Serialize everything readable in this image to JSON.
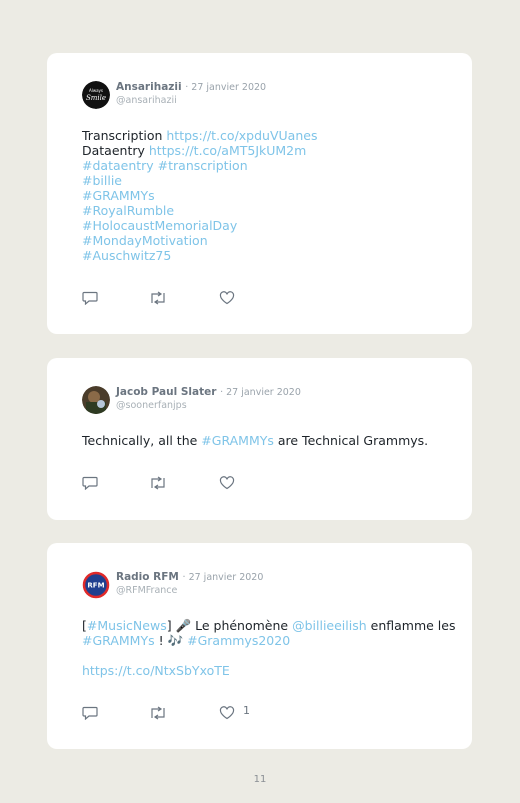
{
  "tweets": [
    {
      "name": "Ansarihazii",
      "date": "· 27 janvier 2020",
      "handle": "@ansarihazii",
      "lines": [
        [
          {
            "t": "Transcription ",
            "link": false
          },
          {
            "t": "https://t.co/xpduVUanes",
            "link": true
          }
        ],
        [
          {
            "t": "Dataentry ",
            "link": false
          },
          {
            "t": "https://t.co/aMT5JkUM2m",
            "link": true
          }
        ],
        [
          {
            "t": "#dataentry #transcription",
            "link": true
          }
        ],
        [
          {
            "t": "#billie",
            "link": true
          }
        ],
        [
          {
            "t": "#GRAMMYs",
            "link": true
          }
        ],
        [
          {
            "t": "#RoyalRumble",
            "link": true
          }
        ],
        [
          {
            "t": "#HolocaustMemorialDay",
            "link": true
          }
        ],
        [
          {
            "t": "#MondayMotivation",
            "link": true
          }
        ],
        [
          {
            "t": "#Auschwitz75",
            "link": true
          }
        ]
      ],
      "like_count": ""
    },
    {
      "name": "Jacob Paul Slater",
      "date": "· 27 janvier 2020",
      "handle": "@soonerfanjps",
      "lines": [
        [
          {
            "t": "Technically, all the ",
            "link": false
          },
          {
            "t": "#GRAMMYs",
            "link": true
          },
          {
            "t": " are Technical Grammys.",
            "link": false
          }
        ]
      ],
      "like_count": ""
    },
    {
      "name": "Radio RFM",
      "date": "· 27 janvier 2020",
      "handle": "@RFMFrance",
      "lines": [
        [
          {
            "t": "[",
            "link": false
          },
          {
            "t": "#MusicNews",
            "link": true
          },
          {
            "t": "] 🎤 Le phénomène ",
            "link": false
          },
          {
            "t": "@billieeilish",
            "link": true
          },
          {
            "t": " enflamme les",
            "link": false
          }
        ],
        [
          {
            "t": "#GRAMMYs",
            "link": true
          },
          {
            "t": " ! 🎶 ",
            "link": false
          },
          {
            "t": "#Grammys2020",
            "link": true
          }
        ],
        [],
        [
          {
            "t": "https://t.co/NtxSbYxoTE",
            "link": true
          }
        ]
      ],
      "like_count": "1"
    }
  ],
  "page_number": "11",
  "colors": {
    "link": "#7fc4e8",
    "background": "#ecebe4",
    "card": "#ffffff"
  },
  "icons": [
    "reply-icon",
    "retweet-icon",
    "like-icon"
  ]
}
